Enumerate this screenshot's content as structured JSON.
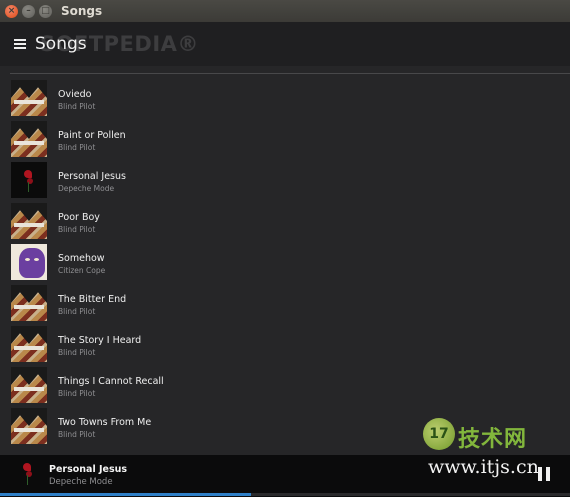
{
  "window": {
    "title": "Songs",
    "close_glyph": "×",
    "min_glyph": "–",
    "max_glyph": "□"
  },
  "header": {
    "title": "Songs",
    "menu_icon": "hamburger-icon",
    "watermark": "SOFTPEDIA®"
  },
  "songs": [
    {
      "title": "Oviedo",
      "artist": "Blind Pilot",
      "art": "blind-pilot"
    },
    {
      "title": "Paint or Pollen",
      "artist": "Blind Pilot",
      "art": "blind-pilot"
    },
    {
      "title": "Personal Jesus",
      "artist": "Depeche Mode",
      "art": "depeche-mode"
    },
    {
      "title": "Poor Boy",
      "artist": "Blind Pilot",
      "art": "blind-pilot"
    },
    {
      "title": "Somehow",
      "artist": "Citizen Cope",
      "art": "citizen-cope"
    },
    {
      "title": "The Bitter End",
      "artist": "Blind Pilot",
      "art": "blind-pilot"
    },
    {
      "title": "The Story I Heard",
      "artist": "Blind Pilot",
      "art": "blind-pilot"
    },
    {
      "title": "Things I Cannot Recall",
      "artist": "Blind Pilot",
      "art": "blind-pilot"
    },
    {
      "title": "Two Towns From Me",
      "artist": "Blind Pilot",
      "art": "blind-pilot"
    }
  ],
  "now_playing": {
    "title": "Personal Jesus",
    "artist": "Depeche Mode",
    "progress_fraction": 0.44,
    "state_icon": "pause-icon"
  },
  "site_watermark": {
    "logo_text": "17",
    "name": "技术网",
    "url": "www.itjs.cn"
  },
  "colors": {
    "accent": "#2f80c8",
    "background": "#262628",
    "header": "#1f1f21",
    "player": "#0b0b0c"
  }
}
